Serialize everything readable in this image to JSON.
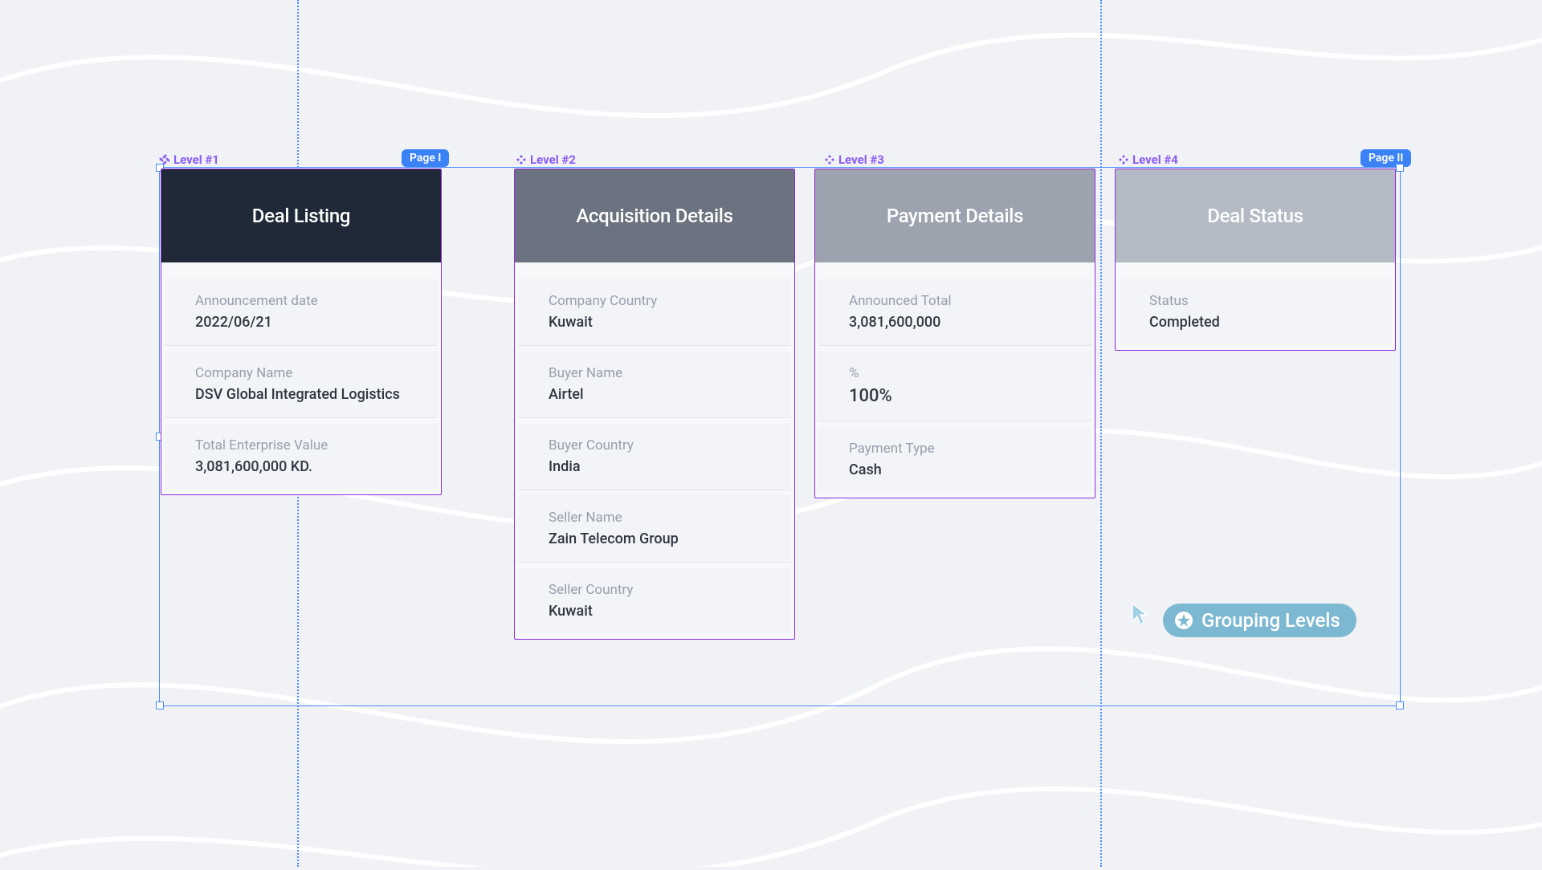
{
  "page_badges": {
    "p1": "Page I",
    "p2": "Page II"
  },
  "levels": {
    "l1": "Level #1",
    "l2": "Level #2",
    "l3": "Level #3",
    "l4": "Level #4"
  },
  "cards": {
    "deal_listing": {
      "title": "Deal Listing",
      "announcement_date": {
        "label": "Announcement date",
        "value": "2022/06/21"
      },
      "company_name": {
        "label": "Company Name",
        "value": "DSV Global Integrated Logistics"
      },
      "tev": {
        "label": "Total Enterprise Value",
        "value": "3,081,600,000 KD."
      }
    },
    "acquisition": {
      "title": "Acquisition Details",
      "company_country": {
        "label": "Company Country",
        "value": "Kuwait"
      },
      "buyer_name": {
        "label": "Buyer Name",
        "value": "Airtel"
      },
      "buyer_country": {
        "label": "Buyer Country",
        "value": "India"
      },
      "seller_name": {
        "label": "Seller Name",
        "value": "Zain Telecom Group"
      },
      "seller_country": {
        "label": "Seller Country",
        "value": "Kuwait"
      }
    },
    "payment": {
      "title": "Payment Details",
      "announced_total": {
        "label": "Announced Total",
        "value": "3,081,600,000"
      },
      "percent": {
        "label": "%",
        "value": "100%"
      },
      "payment_type": {
        "label": "Payment Type",
        "value": "Cash"
      }
    },
    "status": {
      "title": "Deal Status",
      "status": {
        "label": "Status",
        "value": "Completed"
      }
    }
  },
  "grouping_button": "Grouping Levels"
}
